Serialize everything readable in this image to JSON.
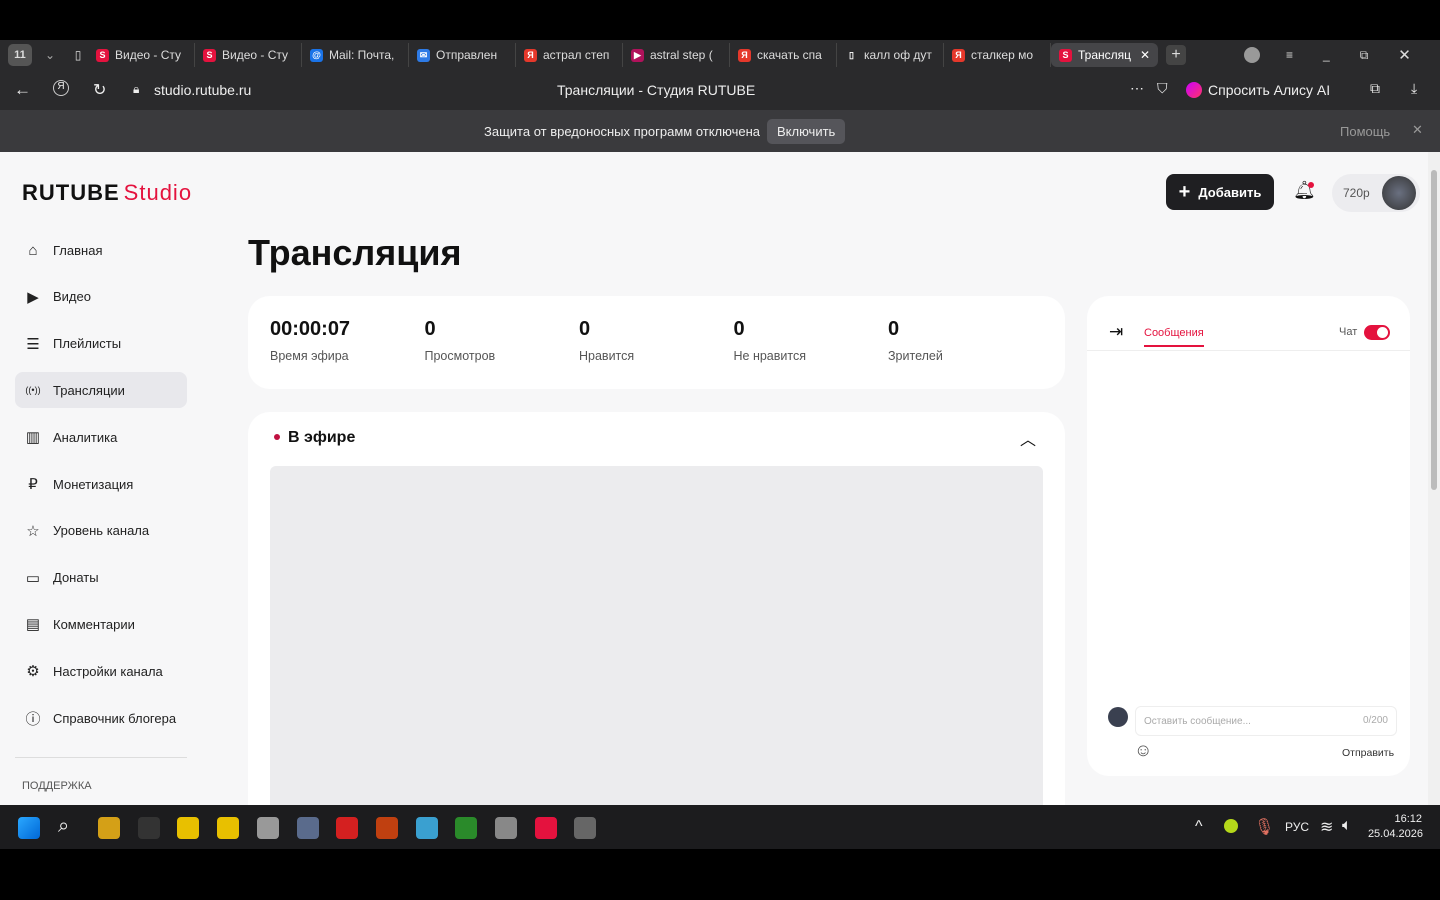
{
  "browser": {
    "tab_counter": "11",
    "tabs": [
      {
        "label": "Видео - Сту",
        "icon": "rutube"
      },
      {
        "label": "Видео - Сту",
        "icon": "rutube"
      },
      {
        "label": "Mail: Почта,",
        "icon": "mail"
      },
      {
        "label": "Отправлен",
        "icon": "mail-envelope"
      },
      {
        "label": "астрал степ",
        "icon": "yandex"
      },
      {
        "label": "astral step (",
        "icon": "video"
      },
      {
        "label": "скачать спа",
        "icon": "yandex"
      },
      {
        "label": "калл оф дут",
        "icon": "document"
      },
      {
        "label": "сталкер мо",
        "icon": "yandex"
      },
      {
        "label": "Трансляц",
        "icon": "rutube",
        "active": true
      }
    ],
    "url": "studio.rutube.ru",
    "page_title": "Трансляции - Студия RUTUBE",
    "alice_label": "Спросить Алису AI",
    "notice": "Защита от вредоносных программ отключена",
    "notice_button": "Включить",
    "help": "Помощь"
  },
  "header": {
    "logo_main": "RUTUBE",
    "logo_sub": "Studio",
    "add_button": "Добавить",
    "quality": "720p"
  },
  "sidebar": {
    "items": [
      {
        "label": "Главная",
        "icon": "home"
      },
      {
        "label": "Видео",
        "icon": "video"
      },
      {
        "label": "Плейлисты",
        "icon": "playlist"
      },
      {
        "label": "Трансляции",
        "icon": "broadcast",
        "active": true
      },
      {
        "label": "Аналитика",
        "icon": "analytics"
      },
      {
        "label": "Монетизация",
        "icon": "ruble"
      },
      {
        "label": "Уровень канала",
        "icon": "star"
      },
      {
        "label": "Донаты",
        "icon": "wallet"
      },
      {
        "label": "Комментарии",
        "icon": "comment"
      },
      {
        "label": "Настройки канала",
        "icon": "gear"
      },
      {
        "label": "Справочник блогера",
        "icon": "info"
      }
    ],
    "support_heading": "ПОДДЕРЖКА"
  },
  "main": {
    "title": "Трансляция",
    "stats": [
      {
        "value": "00:00:07",
        "label": "Время эфира"
      },
      {
        "value": "0",
        "label": "Просмотров"
      },
      {
        "value": "0",
        "label": "Нравится"
      },
      {
        "value": "0",
        "label": "Не нравится"
      },
      {
        "value": "0",
        "label": "Зрителей"
      }
    ],
    "live_label": "В эфире"
  },
  "chat": {
    "tab": "Сообщения",
    "toggle_label": "Чат",
    "toggle_on": true,
    "placeholder": "Оставить сообщение...",
    "counter": "0/200",
    "send": "Отправить"
  },
  "taskbar": {
    "lang": "РУС",
    "time": "16:12",
    "date": "25.04.2026"
  },
  "colors": {
    "accent": "#e4123e",
    "dark": "#1f1f22"
  }
}
